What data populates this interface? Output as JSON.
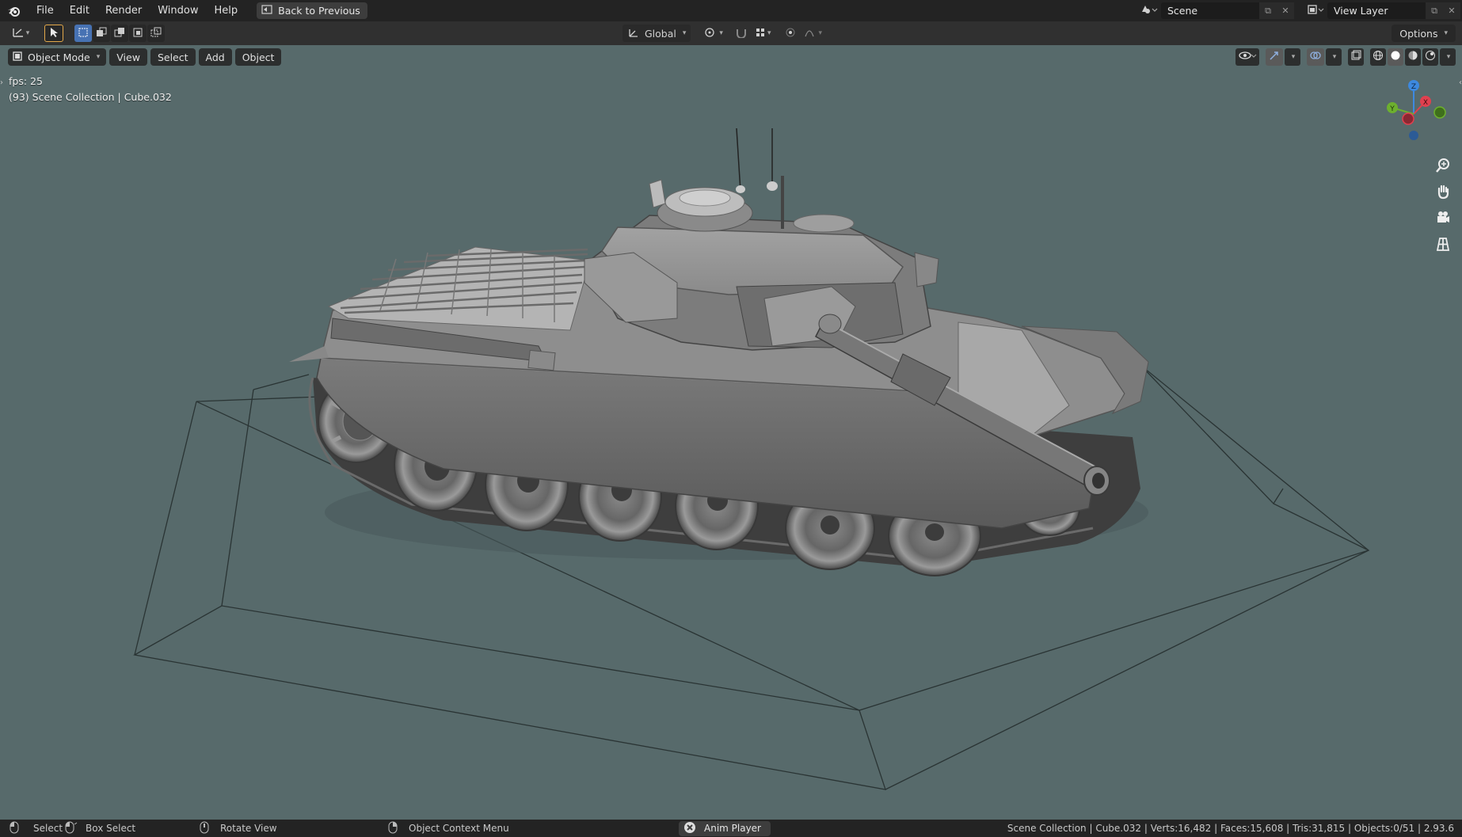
{
  "menu": {
    "items": [
      "File",
      "Edit",
      "Render",
      "Window",
      "Help"
    ],
    "back_button": "Back to Previous"
  },
  "top_right": {
    "scene_name": "Scene",
    "view_layer_name": "View Layer"
  },
  "tool_header": {
    "transform_orientation": "Global",
    "options_label": "Options"
  },
  "viewport_header": {
    "mode": "Object Mode",
    "menus": [
      "View",
      "Select",
      "Add",
      "Object"
    ]
  },
  "viewport_info": {
    "fps": "fps: 25",
    "collection": "(93) Scene Collection | Cube.032"
  },
  "gizmo": {
    "axes": [
      "X",
      "Y",
      "Z"
    ],
    "colors": {
      "x": "#e0404f",
      "y": "#6db02e",
      "z": "#3d89e0"
    }
  },
  "status_bar": {
    "select": "Select",
    "box_select": "Box Select",
    "rotate_view": "Rotate View",
    "context_menu": "Object Context Menu",
    "anim_player": "Anim Player",
    "stats": "Scene Collection | Cube.032 | Verts:16,482 | Faces:15,608 | Tris:31,815 | Objects:0/51 | 2.93.6"
  },
  "icons": [
    "blender-logo-icon",
    "back-icon",
    "editor-type-icon",
    "select-tool-icon",
    "box-mode-icons",
    "transform-icon",
    "pivot-icon",
    "snap-icon",
    "proportional-icon",
    "falloff-icon",
    "mode-icon",
    "visibility-icon",
    "gizmo-icon",
    "overlay-icon",
    "xray-icon",
    "shading-wireframe-icon",
    "shading-solid-icon",
    "shading-material-icon",
    "shading-rendered-icon",
    "zoom-icon",
    "pan-hand-icon",
    "camera-icon",
    "grid-icon",
    "mouse-icon",
    "cancel-icon"
  ],
  "theme": {
    "viewport_bg": "#576a6b",
    "header_bg": "#303030",
    "accent": "#4772b3"
  }
}
